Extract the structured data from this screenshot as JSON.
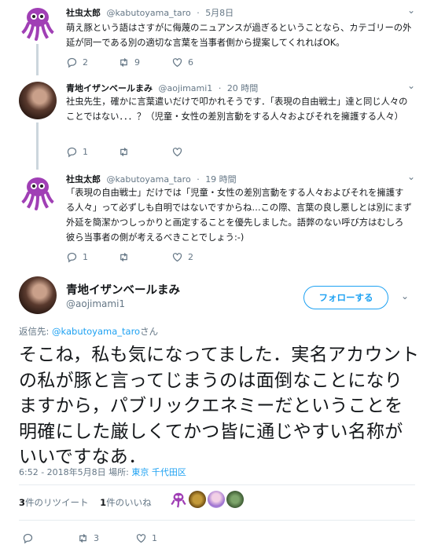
{
  "tweets": [
    {
      "name": "社虫太郎",
      "handle": "@kabutoyama_taro",
      "time": "5月8日",
      "text": "萌え豚という語はさすがに侮蔑のニュアンスが過ぎるということなら、カテゴリーの外延が同一である別の適切な言葉を当事者側から提案してくれればOK。",
      "replies": "2",
      "retweets": "9",
      "likes": "6"
    },
    {
      "name": "青地イザンベールまみ",
      "handle": "@aojimami1",
      "time": "20 時間",
      "text": "社虫先生，確かに言葉遣いだけで叩かれそうです．「表現の自由戦士」達と同じ人々のことではない．．．？（児童・女性の差別言動をする人々およびそれを擁護する人々）",
      "replies": "1",
      "retweets": "",
      "likes": ""
    },
    {
      "name": "社虫太郎",
      "handle": "@kabutoyama_taro",
      "time": "19 時間",
      "text": "「表現の自由戦士」だけでは「児童・女性の差別言動をする人々およびそれを擁護する人々」って必ずしも自明ではないですからね…この際、言葉の良し悪しとは別にまず外延を簡潔かつしっかりと画定することを優先しました。語弊のない呼び方はむしろ彼ら当事者の側が考えるべきことでしょう:-)",
      "replies": "1",
      "retweets": "",
      "likes": "2"
    }
  ],
  "main": {
    "name": "青地イザンベールまみ",
    "handle": "@aojimami1",
    "follow_label": "フォローする",
    "replying_prefix": "返信先: ",
    "replying_mention": "@kabutoyama_taro",
    "replying_suffix": "さん",
    "text": "そこね，私も気になってました．実名アカウントの私が豚と言ってじまうのは面倒なことになりますから，パブリックエネミーだということを明確にした厳しくてかつ皆に通じやすい名称がいいですなあ．",
    "datetime": "6:52 - 2018年5月8日",
    "location_label": "場所:",
    "location": "東京 千代田区",
    "retweet_count": "3",
    "retweet_text": "件のリツイート",
    "like_count": "1",
    "like_text": "件のいいね",
    "action_retweets": "3",
    "action_likes": "1"
  },
  "colors": {
    "accent": "#1da1f2",
    "muted": "#657786",
    "text": "#14171a",
    "divider": "#e6ecf0",
    "octopus": "#a03fb5"
  },
  "icons": [
    "reply-icon",
    "retweet-icon",
    "like-icon",
    "chevron-down-icon",
    "octopus-avatar"
  ]
}
